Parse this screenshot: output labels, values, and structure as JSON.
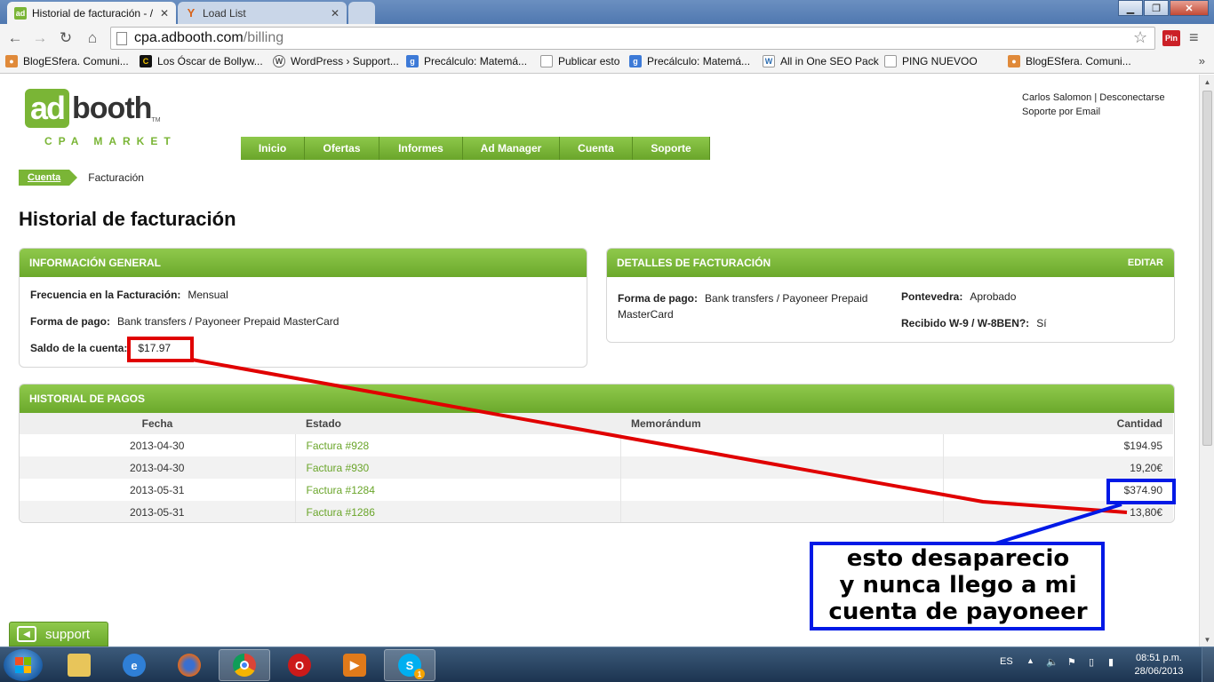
{
  "browser": {
    "tabs": [
      {
        "title": "Historial de facturación - /",
        "favicon": "adbooth-favicon-icon",
        "active": true
      },
      {
        "title": "Load List",
        "favicon": "yoast-favicon-icon",
        "active": false
      },
      {
        "title": "",
        "favicon": "",
        "active": false
      }
    ],
    "url_host": "cpa.adbooth.com",
    "url_path": "/billing",
    "pin_label": "Pin"
  },
  "bookmarks": [
    "BlogESfera. Comuni...",
    "Los Óscar de Bollyw...",
    "WordPress › Support...",
    "Precálculo: Matemá...",
    "Publicar esto",
    "Precálculo: Matemá...",
    "All in One SEO Pack",
    "PING NUEVOO",
    "BlogESfera. Comuni..."
  ],
  "site": {
    "logo_ad": "ad",
    "logo_booth": "booth",
    "logo_tm": "TM",
    "logo_tagline": "CPA MARKET",
    "user_name": "Carlos Salomon",
    "separator": " | ",
    "logout": "Desconectarse",
    "support_email": "Soporte por Email",
    "nav": [
      "Inicio",
      "Ofertas",
      "Informes",
      "Ad Manager",
      "Cuenta",
      "Soporte"
    ],
    "breadcrumb_link": "Cuenta",
    "breadcrumb_current": "Facturación",
    "page_title": "Historial de facturación",
    "support_tab": "support"
  },
  "general_info": {
    "header": "INFORMACIÓN GENERAL",
    "freq_label": "Frecuencia en la Facturación:",
    "freq_value": "Mensual",
    "payment_label": "Forma de pago:",
    "payment_value": "Bank transfers / Payoneer Prepaid MasterCard",
    "balance_label": "Saldo de la cuenta:",
    "balance_value": "$17.97"
  },
  "billing_details": {
    "header": "DETALLES DE FACTURACIÓN",
    "edit": "EDITAR",
    "payment_label": "Forma de pago:",
    "payment_value_1": "Bank transfers / Payoneer Prepaid",
    "payment_value_2": "MasterCard",
    "state_label": "Pontevedra:",
    "state_value": "Aprobado",
    "w9_label": "Recibido W-9 / W-8BEN?:",
    "w9_value": "Sí"
  },
  "payments": {
    "header": "HISTORIAL DE PAGOS",
    "columns": [
      "Fecha",
      "Estado",
      "Memorándum",
      "Cantidad"
    ],
    "rows": [
      {
        "date": "2013-04-30",
        "status": "Factura #928",
        "memo": "",
        "amount": "$194.95"
      },
      {
        "date": "2013-04-30",
        "status": "Factura #930",
        "memo": "",
        "amount": "19,20€"
      },
      {
        "date": "2013-05-31",
        "status": "Factura #1284",
        "memo": "",
        "amount": "$374.90"
      },
      {
        "date": "2013-05-31",
        "status": "Factura #1286",
        "memo": "",
        "amount": "13,80€"
      }
    ]
  },
  "annotation": {
    "line1": "esto desaparecio",
    "line2": "y nunca llego a mi",
    "line3": "cuenta de payoneer",
    "red": "#e00000",
    "blue": "#0019e6"
  },
  "taskbar": {
    "lang": "ES",
    "time": "08:51 p.m.",
    "date": "28/06/2013",
    "skype_badge": "1"
  },
  "colors": {
    "brand_green": "#7ab536",
    "link_green": "#6aa52a"
  }
}
